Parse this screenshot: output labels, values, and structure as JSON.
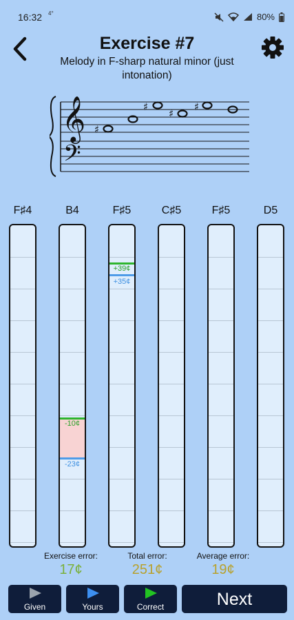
{
  "status_bar": {
    "time": "16:32",
    "extra": "4°",
    "battery": "80%"
  },
  "header": {
    "title": "Exercise #7",
    "subtitle": "Melody in F-sharp natural minor (just intonation)"
  },
  "columns": [
    {
      "label": "F♯4"
    },
    {
      "label": "B4",
      "given_cents": "-10¢",
      "yours_cents": "-23¢"
    },
    {
      "label": "F♯5",
      "given_cents": "+39¢",
      "yours_cents": "+35¢"
    },
    {
      "label": "C♯5"
    },
    {
      "label": "F♯5"
    },
    {
      "label": "D5"
    }
  ],
  "errors": {
    "exercise_label": "Exercise error:",
    "exercise_value": "17¢",
    "total_label": "Total error:",
    "total_value": "251¢",
    "average_label": "Average error:",
    "average_value": "19¢"
  },
  "buttons": {
    "given": "Given",
    "yours": "Yours",
    "correct": "Correct",
    "next": "Next"
  },
  "colors": {
    "background": "#aed0f7",
    "button": "#0f1d3a",
    "given_marker": "#2db52d",
    "yours_marker": "#4f9ce8",
    "error_fill": "#f8d3d3"
  },
  "icons": {
    "back": "chevron-left-icon",
    "settings": "gear-icon",
    "given": "play-icon",
    "yours": "play-icon",
    "correct": "play-icon"
  }
}
